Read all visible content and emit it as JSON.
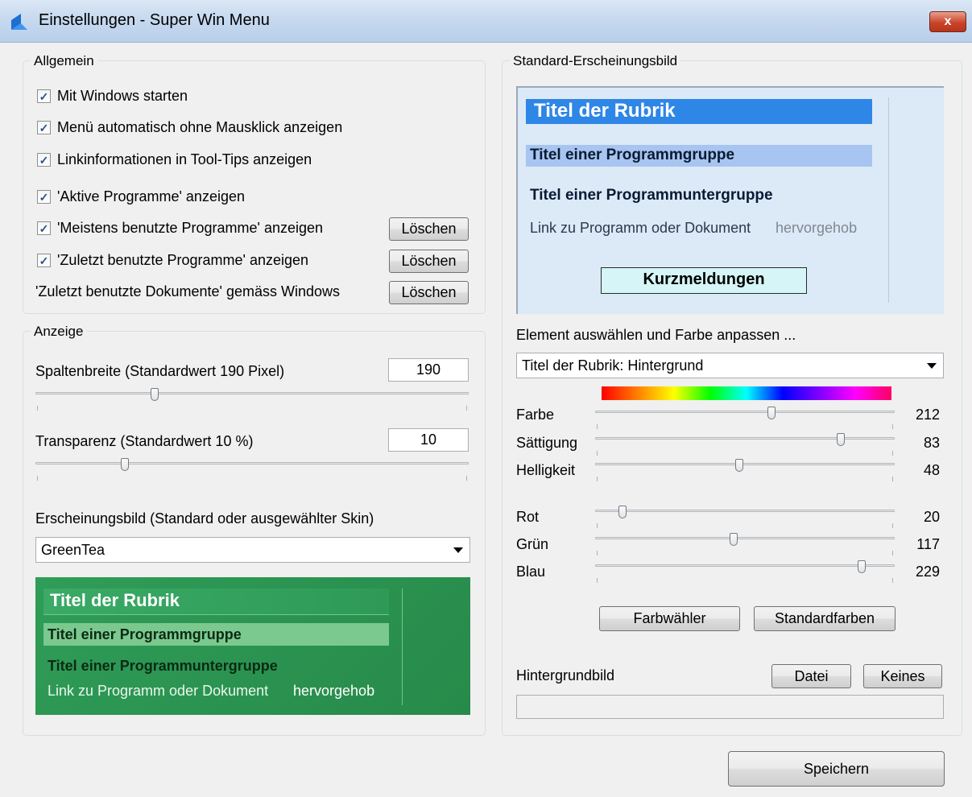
{
  "window": {
    "title": "Einstellungen - Super Win Menu",
    "close_glyph": "x"
  },
  "general": {
    "label": "Allgemein",
    "items": [
      {
        "label": "Mit Windows starten",
        "checked": true
      },
      {
        "label": "Menü automatisch ohne Mausklick anzeigen",
        "checked": true
      },
      {
        "label": "Linkinformationen in Tool-Tips anzeigen",
        "checked": true
      },
      {
        "label": "'Aktive Programme' anzeigen",
        "checked": true
      },
      {
        "label": "'Meistens benutzte Programme' anzeigen",
        "checked": true
      },
      {
        "label": "'Zuletzt benutzte Programme' anzeigen",
        "checked": true
      }
    ],
    "recent_docs_label": "'Zuletzt benutzte Dokumente' gemäss Windows",
    "clear_label": "Löschen"
  },
  "display": {
    "label": "Anzeige",
    "column_width_label": "Spaltenbreite  (Standardwert 190 Pixel)",
    "column_width_value": "190",
    "column_width_level": 0.27,
    "transparency_label": "Transparenz  (Standardwert 10 %)",
    "transparency_value": "10",
    "transparency_level": 0.2,
    "skin_label": "Erscheinungsbild (Standard oder ausgewählter Skin)",
    "skin_selected": "GreenTea"
  },
  "preview": {
    "category_title": "Titel der Rubrik",
    "group_title": "Titel einer Programmgruppe",
    "subgroup_title": "Titel einer Programmuntergruppe",
    "link_text": "Link zu Programm oder Dokument",
    "highlight_text": "hervorgehob",
    "news_label": "Kurzmeldungen"
  },
  "appearance": {
    "label": "Standard-Erscheinungsbild",
    "select_prompt": "Element auswählen und Farbe anpassen ...",
    "element_selected": "Titel der Rubrik: Hintergrund",
    "sliders_hsl": [
      {
        "label": "Farbe",
        "value": "212",
        "level": 0.59
      },
      {
        "label": "Sättigung",
        "value": "83",
        "level": 0.83
      },
      {
        "label": "Helligkeit",
        "value": "48",
        "level": 0.48
      }
    ],
    "sliders_rgb": [
      {
        "label": "Rot",
        "value": "20",
        "level": 0.08
      },
      {
        "label": "Grün",
        "value": "117",
        "level": 0.46
      },
      {
        "label": "Blau",
        "value": "229",
        "level": 0.9
      }
    ],
    "color_picker_label": "Farbwähler",
    "default_colors_label": "Standardfarben",
    "background_image_label": "Hintergrundbild",
    "file_label": "Datei",
    "none_label": "Keines",
    "background_image_path": ""
  },
  "save_label": "Speichern",
  "colors": {
    "blue_title_bg": "#2e86e6",
    "blue_group_bg": "#a8c4f0",
    "blue_preview_bg": "#dce9f7",
    "green_preview_bg": "#2e9a55",
    "green_group_bg": "#76c88a"
  }
}
